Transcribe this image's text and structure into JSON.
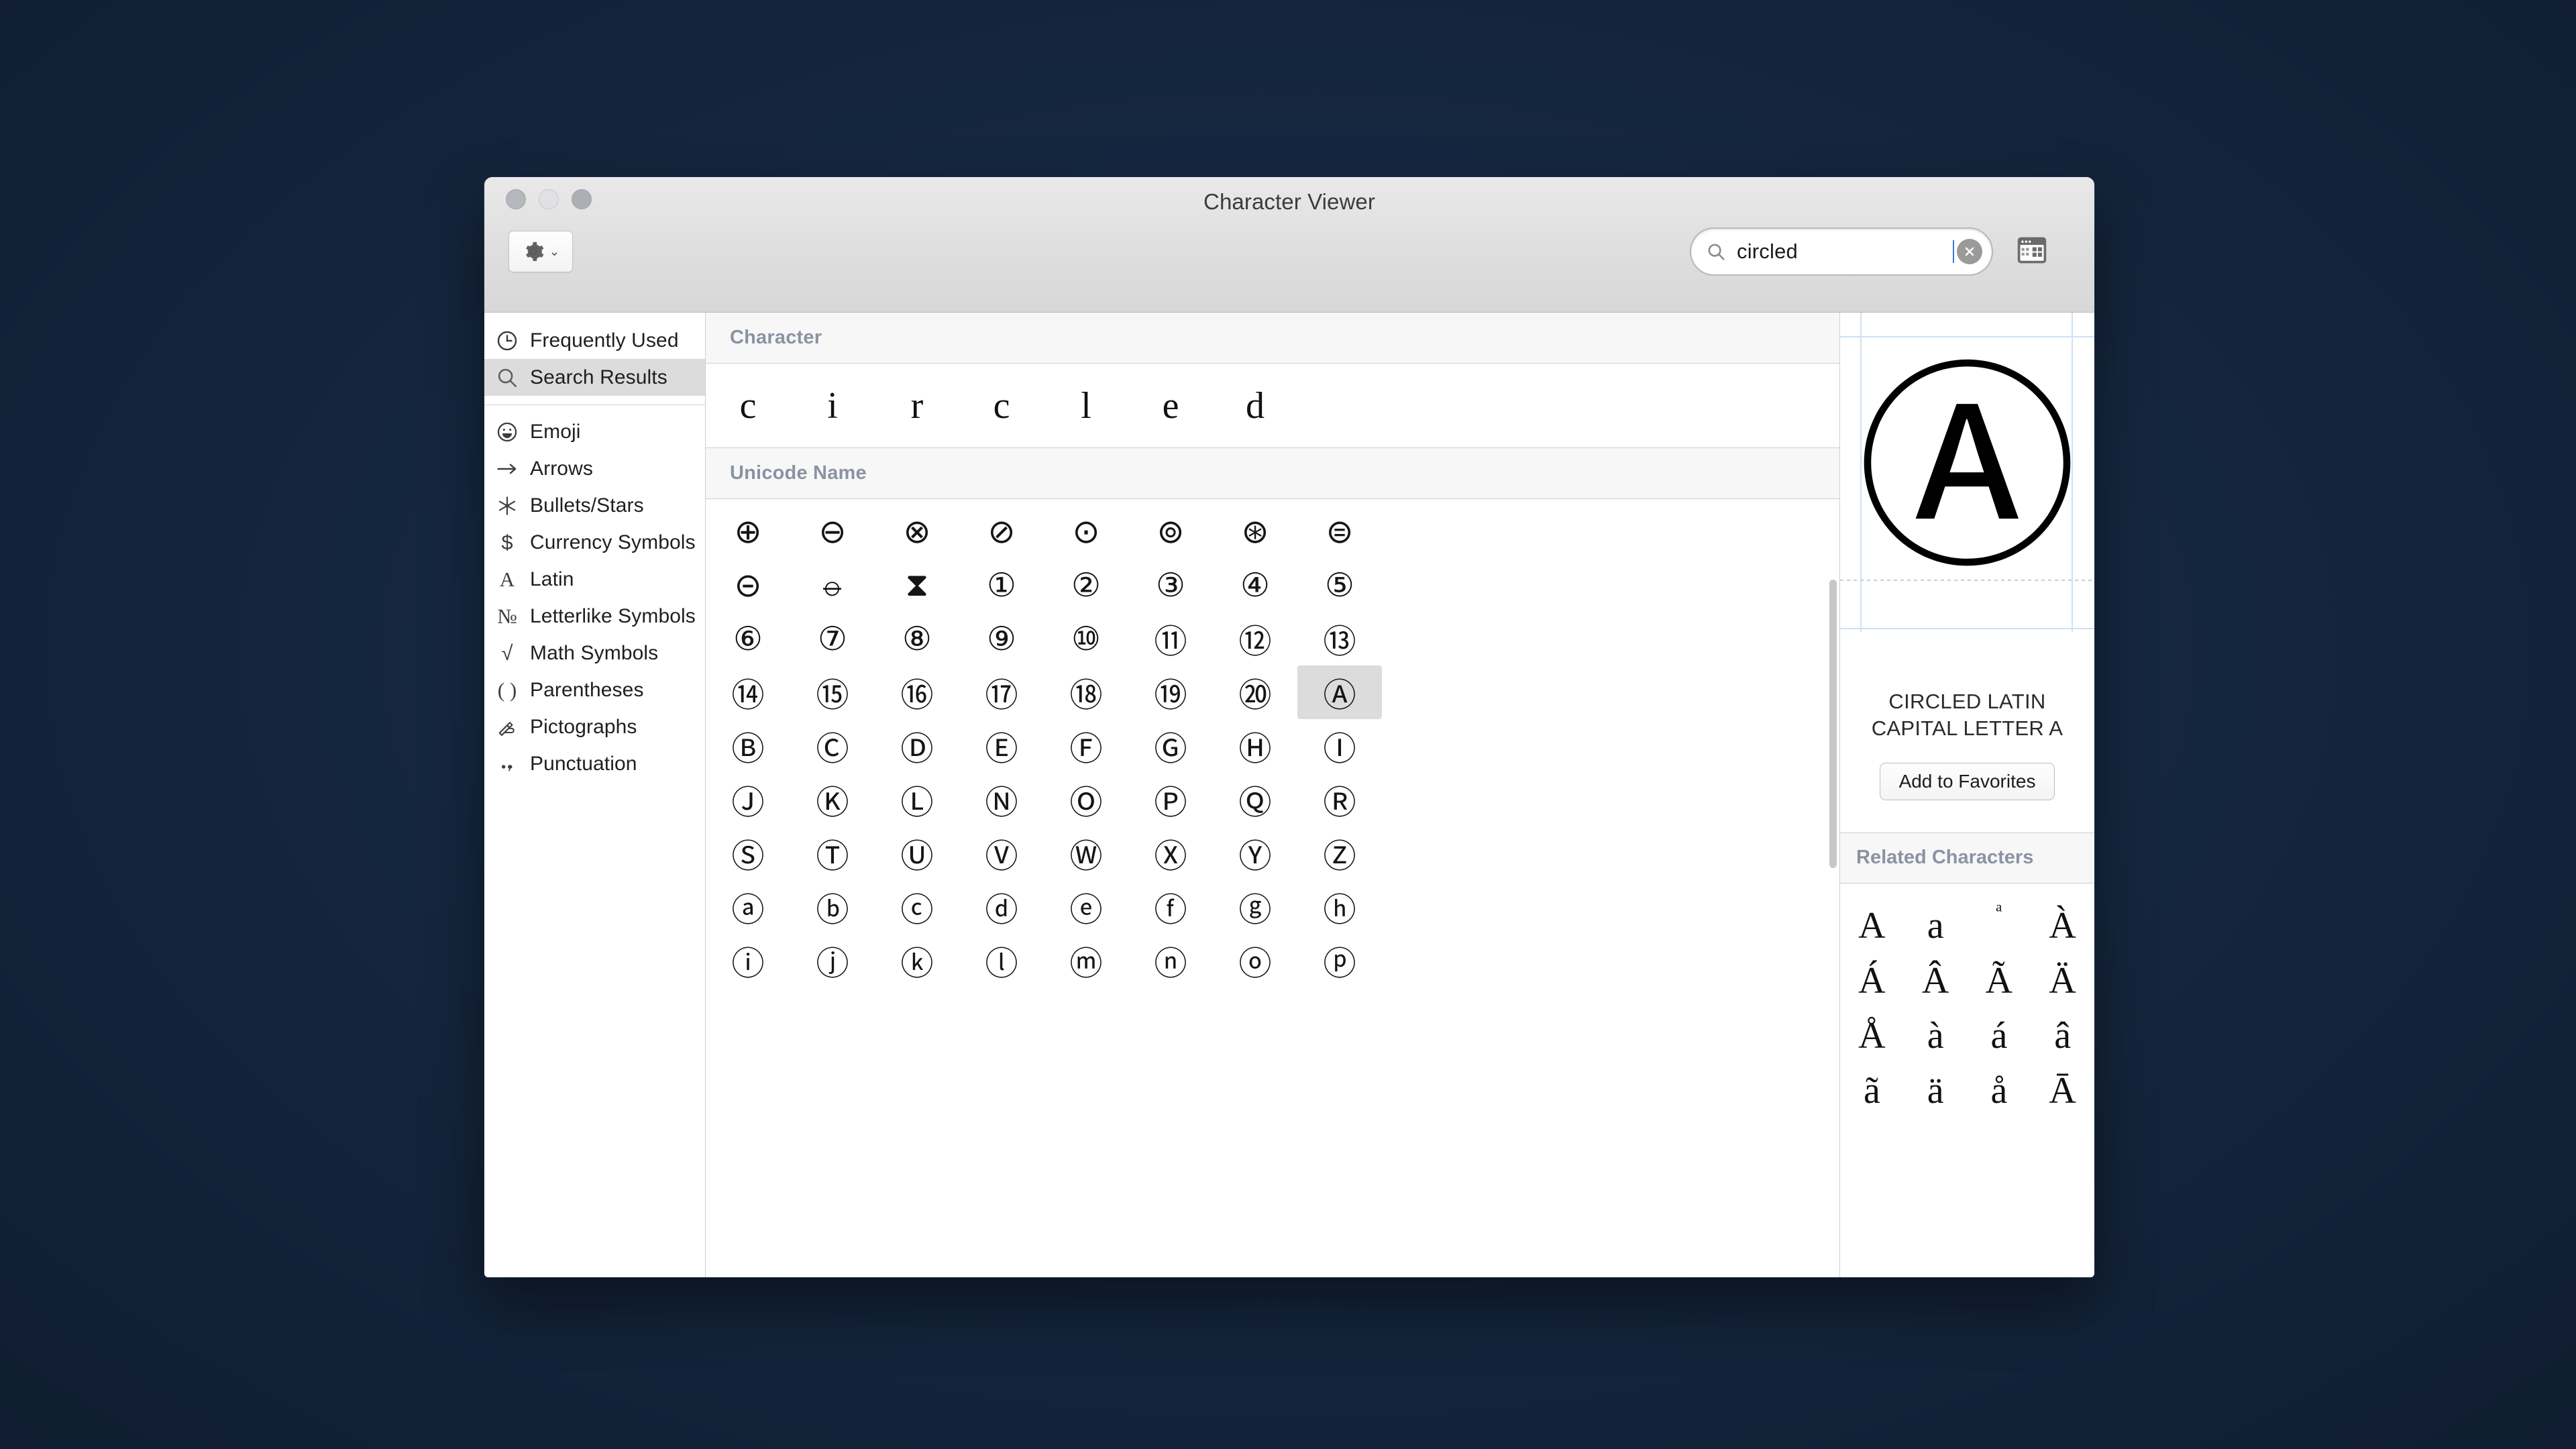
{
  "window": {
    "title": "Character Viewer",
    "controls": {
      "close": "close",
      "minimize": "minimize",
      "maximize": "maximize"
    }
  },
  "toolbar": {
    "gear_button_label": "action-menu",
    "panel_toggle_label": "toggle-panel"
  },
  "search": {
    "value": "circled",
    "placeholder": "Search",
    "clear_label": "Clear search"
  },
  "sidebar": {
    "items": [
      {
        "label": "Frequently Used",
        "icon": "clock-icon",
        "selected": false
      },
      {
        "label": "Search Results",
        "icon": "search-icon",
        "selected": true
      },
      {
        "label": "Emoji",
        "icon": "smiley-icon",
        "selected": false
      },
      {
        "label": "Arrows",
        "icon": "arrow-right-icon",
        "selected": false
      },
      {
        "label": "Bullets/Stars",
        "icon": "asterisk-icon",
        "selected": false
      },
      {
        "label": "Currency Symbols",
        "icon": "dollar-icon",
        "selected": false
      },
      {
        "label": "Latin",
        "icon": "letter-a-icon",
        "selected": false
      },
      {
        "label": "Letterlike Symbols",
        "icon": "numero-icon",
        "selected": false
      },
      {
        "label": "Math Symbols",
        "icon": "radical-icon",
        "selected": false
      },
      {
        "label": "Parentheses",
        "icon": "parentheses-icon",
        "selected": false
      },
      {
        "label": "Pictographs",
        "icon": "pictograph-icon",
        "selected": false
      },
      {
        "label": "Punctuation",
        "icon": "punctuation-icon",
        "selected": false
      }
    ]
  },
  "center": {
    "character_header": "Character",
    "character_row": [
      "c",
      "i",
      "r",
      "c",
      "l",
      "e",
      "d"
    ],
    "unicode_name_header": "Unicode Name",
    "grid": [
      "⊕",
      "⊖",
      "⊗",
      "⊘",
      "⊙",
      "⊚",
      "⊛",
      "⊜",
      "⊝",
      "⦵",
      "⧗",
      "①",
      "②",
      "③",
      "④",
      "⑤",
      "⑥",
      "⑦",
      "⑧",
      "⑨",
      "⑩",
      "⑪",
      "⑫",
      "⑬",
      "⑭",
      "⑮",
      "⑯",
      "⑰",
      "⑱",
      "⑲",
      "⑳",
      "Ⓐ",
      "Ⓑ",
      "Ⓒ",
      "Ⓓ",
      "Ⓔ",
      "Ⓕ",
      "Ⓖ",
      "Ⓗ",
      "Ⓘ",
      "Ⓙ",
      "Ⓚ",
      "Ⓛ",
      "Ⓝ",
      "Ⓞ",
      "Ⓟ",
      "Ⓠ",
      "Ⓡ",
      "Ⓢ",
      "Ⓣ",
      "Ⓤ",
      "Ⓥ",
      "Ⓦ",
      "Ⓧ",
      "Ⓨ",
      "Ⓩ",
      "ⓐ",
      "ⓑ",
      "ⓒ",
      "ⓓ",
      "ⓔ",
      "ⓕ",
      "ⓖ",
      "ⓗ",
      "ⓘ",
      "ⓙ",
      "ⓚ",
      "ⓛ",
      "ⓜ",
      "ⓝ",
      "ⓞ",
      "ⓟ"
    ],
    "selected_index": 31,
    "selected_character": "Ⓐ"
  },
  "detail": {
    "preview_character": "Ⓐ",
    "unicode_name": "CIRCLED LATIN CAPITAL LETTER A",
    "add_to_favorites_label": "Add to Favorites",
    "related_header": "Related Characters",
    "related_characters": [
      "A",
      "a",
      "ᵃ",
      "À",
      "Á",
      "Â",
      "Ã",
      "Ä",
      "Å",
      "à",
      "á",
      "â",
      "ã",
      "ä",
      "å",
      "Ā"
    ]
  },
  "colors": {
    "desktop": "#16273f",
    "titlebar": "#dedede",
    "selection": "#dcdcdc",
    "header_text": "#8a93a3",
    "guide_line": "#cfe0f5"
  }
}
